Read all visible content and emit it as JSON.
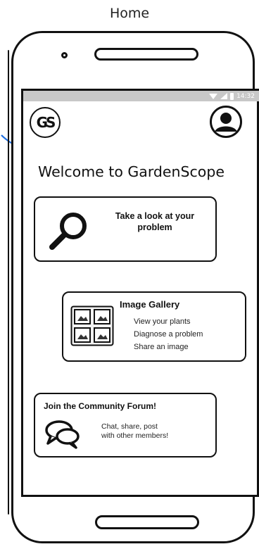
{
  "page_label": "Home",
  "status_bar": {
    "time": "14:32"
  },
  "app": {
    "logo_text": "GS",
    "welcome": "Welcome to GardenScope"
  },
  "cards": {
    "problem": {
      "title": "Take a look at your problem",
      "icon": "search-icon"
    },
    "gallery": {
      "title": "Image Gallery",
      "icon": "image-gallery-icon",
      "items": [
        "View your plants",
        "Diagnose a problem",
        "Share an image"
      ]
    },
    "forum": {
      "title": "Join the Community Forum!",
      "icon": "chat-bubbles-icon",
      "description_line1": "Chat, share, post",
      "description_line2": "with other members!"
    }
  },
  "colors": {
    "arrow": "#1e6fe0",
    "status_bar": "#c8c8c8",
    "outline": "#111111"
  }
}
